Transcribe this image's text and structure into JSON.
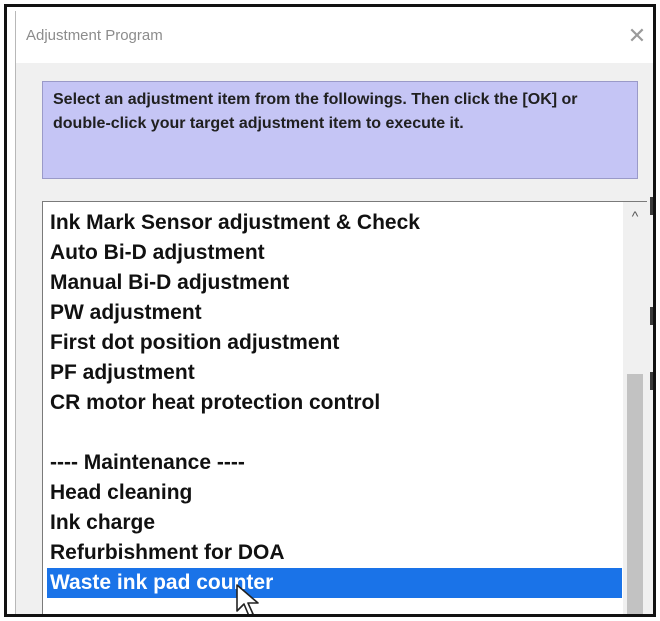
{
  "dialog": {
    "title": "Adjustment Program",
    "close_glyph": "✕",
    "instructions": "Select an adjustment item from the followings. Then click the [OK] or double-click your target adjustment item to execute it."
  },
  "list": {
    "items": [
      {
        "label": "Ink Mark Sensor adjustment & Check"
      },
      {
        "label": "Auto Bi-D adjustment"
      },
      {
        "label": "Manual Bi-D adjustment"
      },
      {
        "label": "PW adjustment"
      },
      {
        "label": "First dot position adjustment"
      },
      {
        "label": "PF adjustment"
      },
      {
        "label": "CR motor heat protection control"
      },
      {
        "label": ""
      },
      {
        "label": "---- Maintenance ----"
      },
      {
        "label": "Head cleaning"
      },
      {
        "label": "Ink charge"
      },
      {
        "label": "Refurbishment for DOA"
      },
      {
        "label": "Waste ink pad counter",
        "selected": true
      }
    ],
    "scroll_up_glyph": "^"
  },
  "colors": {
    "selection": "#1a73e8",
    "instructions_bg": "#c5c5f5"
  },
  "icons": [
    "close-icon",
    "scroll-up-arrow-icon",
    "mouse-pointer-icon"
  ]
}
